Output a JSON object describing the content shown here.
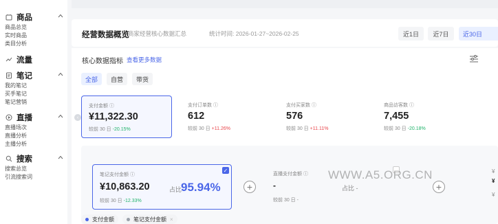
{
  "sidebar": {
    "groups": [
      {
        "title": "商品",
        "items": [
          "商品总览",
          "实时商品",
          "类目分析"
        ]
      },
      {
        "title": "流量",
        "items": []
      },
      {
        "title": "笔记",
        "items": [
          "我的笔记",
          "买手笔记",
          "笔记营销"
        ]
      },
      {
        "title": "直播",
        "items": [
          "直播场次",
          "直播分析",
          "主播分析"
        ]
      },
      {
        "title": "搜索",
        "items": [
          "搜索总览",
          "引流搜索词"
        ]
      }
    ]
  },
  "header": {
    "title": "经营数据概览",
    "subtitle": "商家经营核心数据汇总",
    "stat_time": "统计时间: 2026-01-27~2026-02-25",
    "ranges": [
      "近1日",
      "近7日",
      "近30日"
    ],
    "active_range": "近30日"
  },
  "section": {
    "title": "核心数据指标",
    "link": "查看更多数据"
  },
  "tabs": [
    "全部",
    "自营",
    "带货"
  ],
  "metrics": [
    {
      "label": "支付金额 ⓘ",
      "value": "¥11,322.30",
      "cmp_prefix": "较前 30 日",
      "change": "-20.15%",
      "trend": "down"
    },
    {
      "label": "支付订单数 ⓘ",
      "value": "612",
      "cmp_prefix": "较前 30 日",
      "change": "+11.26%",
      "trend": "up"
    },
    {
      "label": "支付买家数 ⓘ",
      "value": "576",
      "cmp_prefix": "较前 30 日",
      "change": "+11.11%",
      "trend": "up"
    },
    {
      "label": "商品访客数 ⓘ",
      "value": "7,455",
      "cmp_prefix": "较前 30 日",
      "change": "-20.18%",
      "trend": "down"
    }
  ],
  "sub_metrics": {
    "card1": {
      "label": "笔记支付金额 ⓘ",
      "value": "¥10,863.20",
      "ratio_label": "占比",
      "ratio": "95.94%",
      "cmp_prefix": "较前 30 日",
      "change": "-12.33%",
      "check": "✓"
    },
    "card2": {
      "label": "直播支付金额 ⓘ",
      "value": "-",
      "ratio_label": "占比 -",
      "cmp": "较前 30 日 -"
    },
    "plus": "+",
    "edge": [
      "¥",
      "¥",
      "¥"
    ]
  },
  "legend": [
    {
      "label": "支付金额",
      "color": "#4a66e8"
    },
    {
      "label": "笔记支付金额",
      "color": "#9aa0aa",
      "close": "×"
    }
  ],
  "watermark": "WWW.A5.ORG.CN",
  "colors": {
    "accent": "#4a66e8",
    "up": "#e8454a",
    "down": "#21b36b"
  }
}
